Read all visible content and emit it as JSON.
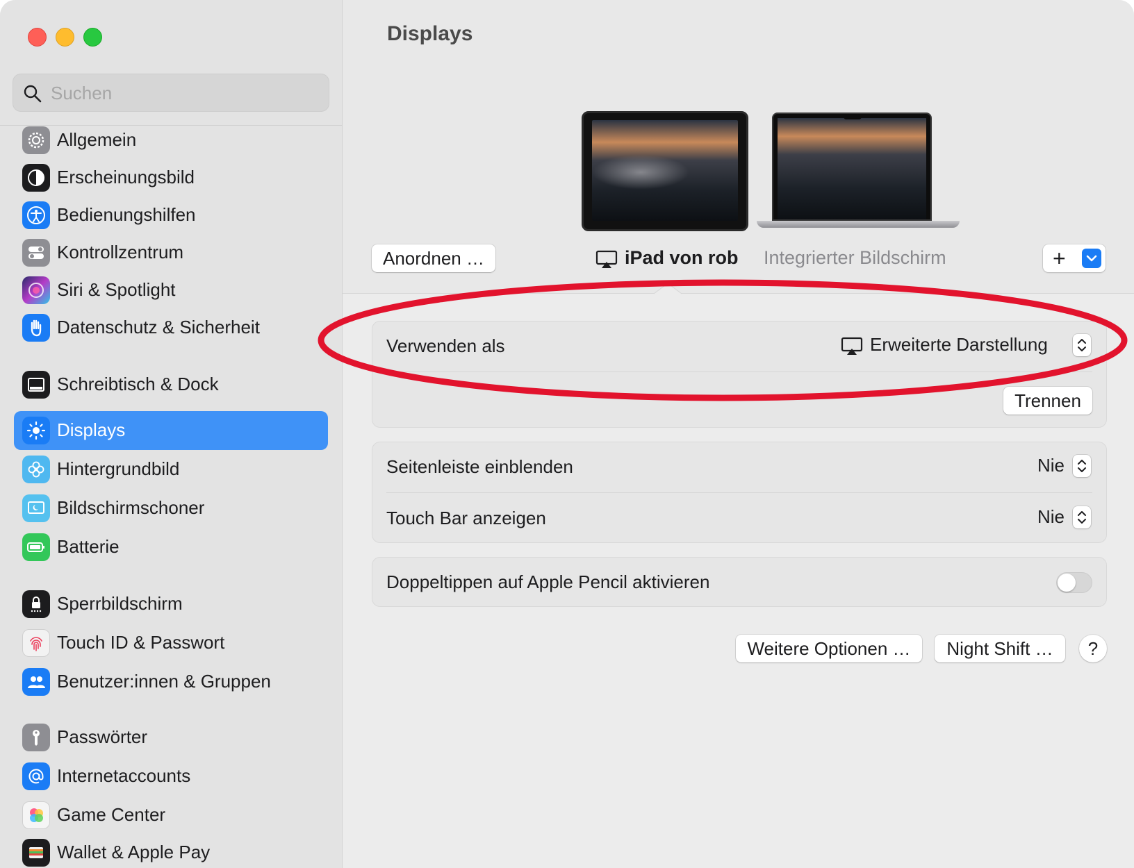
{
  "window": {
    "title": "Displays"
  },
  "sidebar": {
    "search_placeholder": "Suchen",
    "items": [
      {
        "label": "Allgemein",
        "icon": "gear-icon",
        "color": "#8e8e93"
      },
      {
        "label": "Erscheinungsbild",
        "icon": "appearance-icon",
        "color": "#1c1c1e"
      },
      {
        "label": "Bedienungshilfen",
        "icon": "accessibility-icon",
        "color": "#1a7cf5"
      },
      {
        "label": "Kontrollzentrum",
        "icon": "control-center-icon",
        "color": "#8e8e93"
      },
      {
        "label": "Siri & Spotlight",
        "icon": "siri-icon",
        "color": "#7a3cd8"
      },
      {
        "label": "Datenschutz & Sicherheit",
        "icon": "privacy-hand-icon",
        "color": "#1a7cf5"
      },
      {
        "label": "Schreibtisch & Dock",
        "icon": "dock-icon",
        "color": "#1c1c1e"
      },
      {
        "label": "Displays",
        "icon": "brightness-icon",
        "color": "#1a7cf5",
        "active": true
      },
      {
        "label": "Hintergrundbild",
        "icon": "wallpaper-icon",
        "color": "#4fb8f0"
      },
      {
        "label": "Bildschirmschoner",
        "icon": "screensaver-icon",
        "color": "#55c1ef"
      },
      {
        "label": "Batterie",
        "icon": "battery-icon",
        "color": "#33c759"
      },
      {
        "label": "Sperrbildschirm",
        "icon": "lock-icon",
        "color": "#1c1c1e"
      },
      {
        "label": "Touch ID & Passwort",
        "icon": "fingerprint-icon",
        "color": "#f2f2f2"
      },
      {
        "label": "Benutzer:innen & Gruppen",
        "icon": "users-icon",
        "color": "#1a7cf5"
      },
      {
        "label": "Passwörter",
        "icon": "key-icon",
        "color": "#8e8e93"
      },
      {
        "label": "Internetaccounts",
        "icon": "at-icon",
        "color": "#1a7cf5"
      },
      {
        "label": "Game Center",
        "icon": "game-center-icon",
        "color": "#f2f2f2"
      },
      {
        "label": "Wallet & Apple Pay",
        "icon": "wallet-icon",
        "color": "#1c1c1e"
      }
    ]
  },
  "main": {
    "title": "Displays",
    "arrange_button": "Anordnen …",
    "displays": [
      {
        "name": "iPad von rob",
        "icon": "airplay-icon",
        "selected": true
      },
      {
        "name": "Integrierter Bildschirm",
        "selected": false
      }
    ],
    "add_button": "+",
    "use_as": {
      "label": "Verwenden als",
      "value": "Erweiterte Darstellung"
    },
    "disconnect_button": "Trennen",
    "sidebar_row": {
      "label": "Seitenleiste einblenden",
      "value": "Nie"
    },
    "touchbar_row": {
      "label": "Touch Bar anzeigen",
      "value": "Nie"
    },
    "pencil_row": {
      "label": "Doppeltippen auf Apple Pencil aktivieren",
      "enabled": false
    },
    "more_options_button": "Weitere Optionen …",
    "night_shift_button": "Night Shift …",
    "help_button": "?",
    "accent_color": "#1a7cf5",
    "highlight_color": "#e2132d"
  }
}
